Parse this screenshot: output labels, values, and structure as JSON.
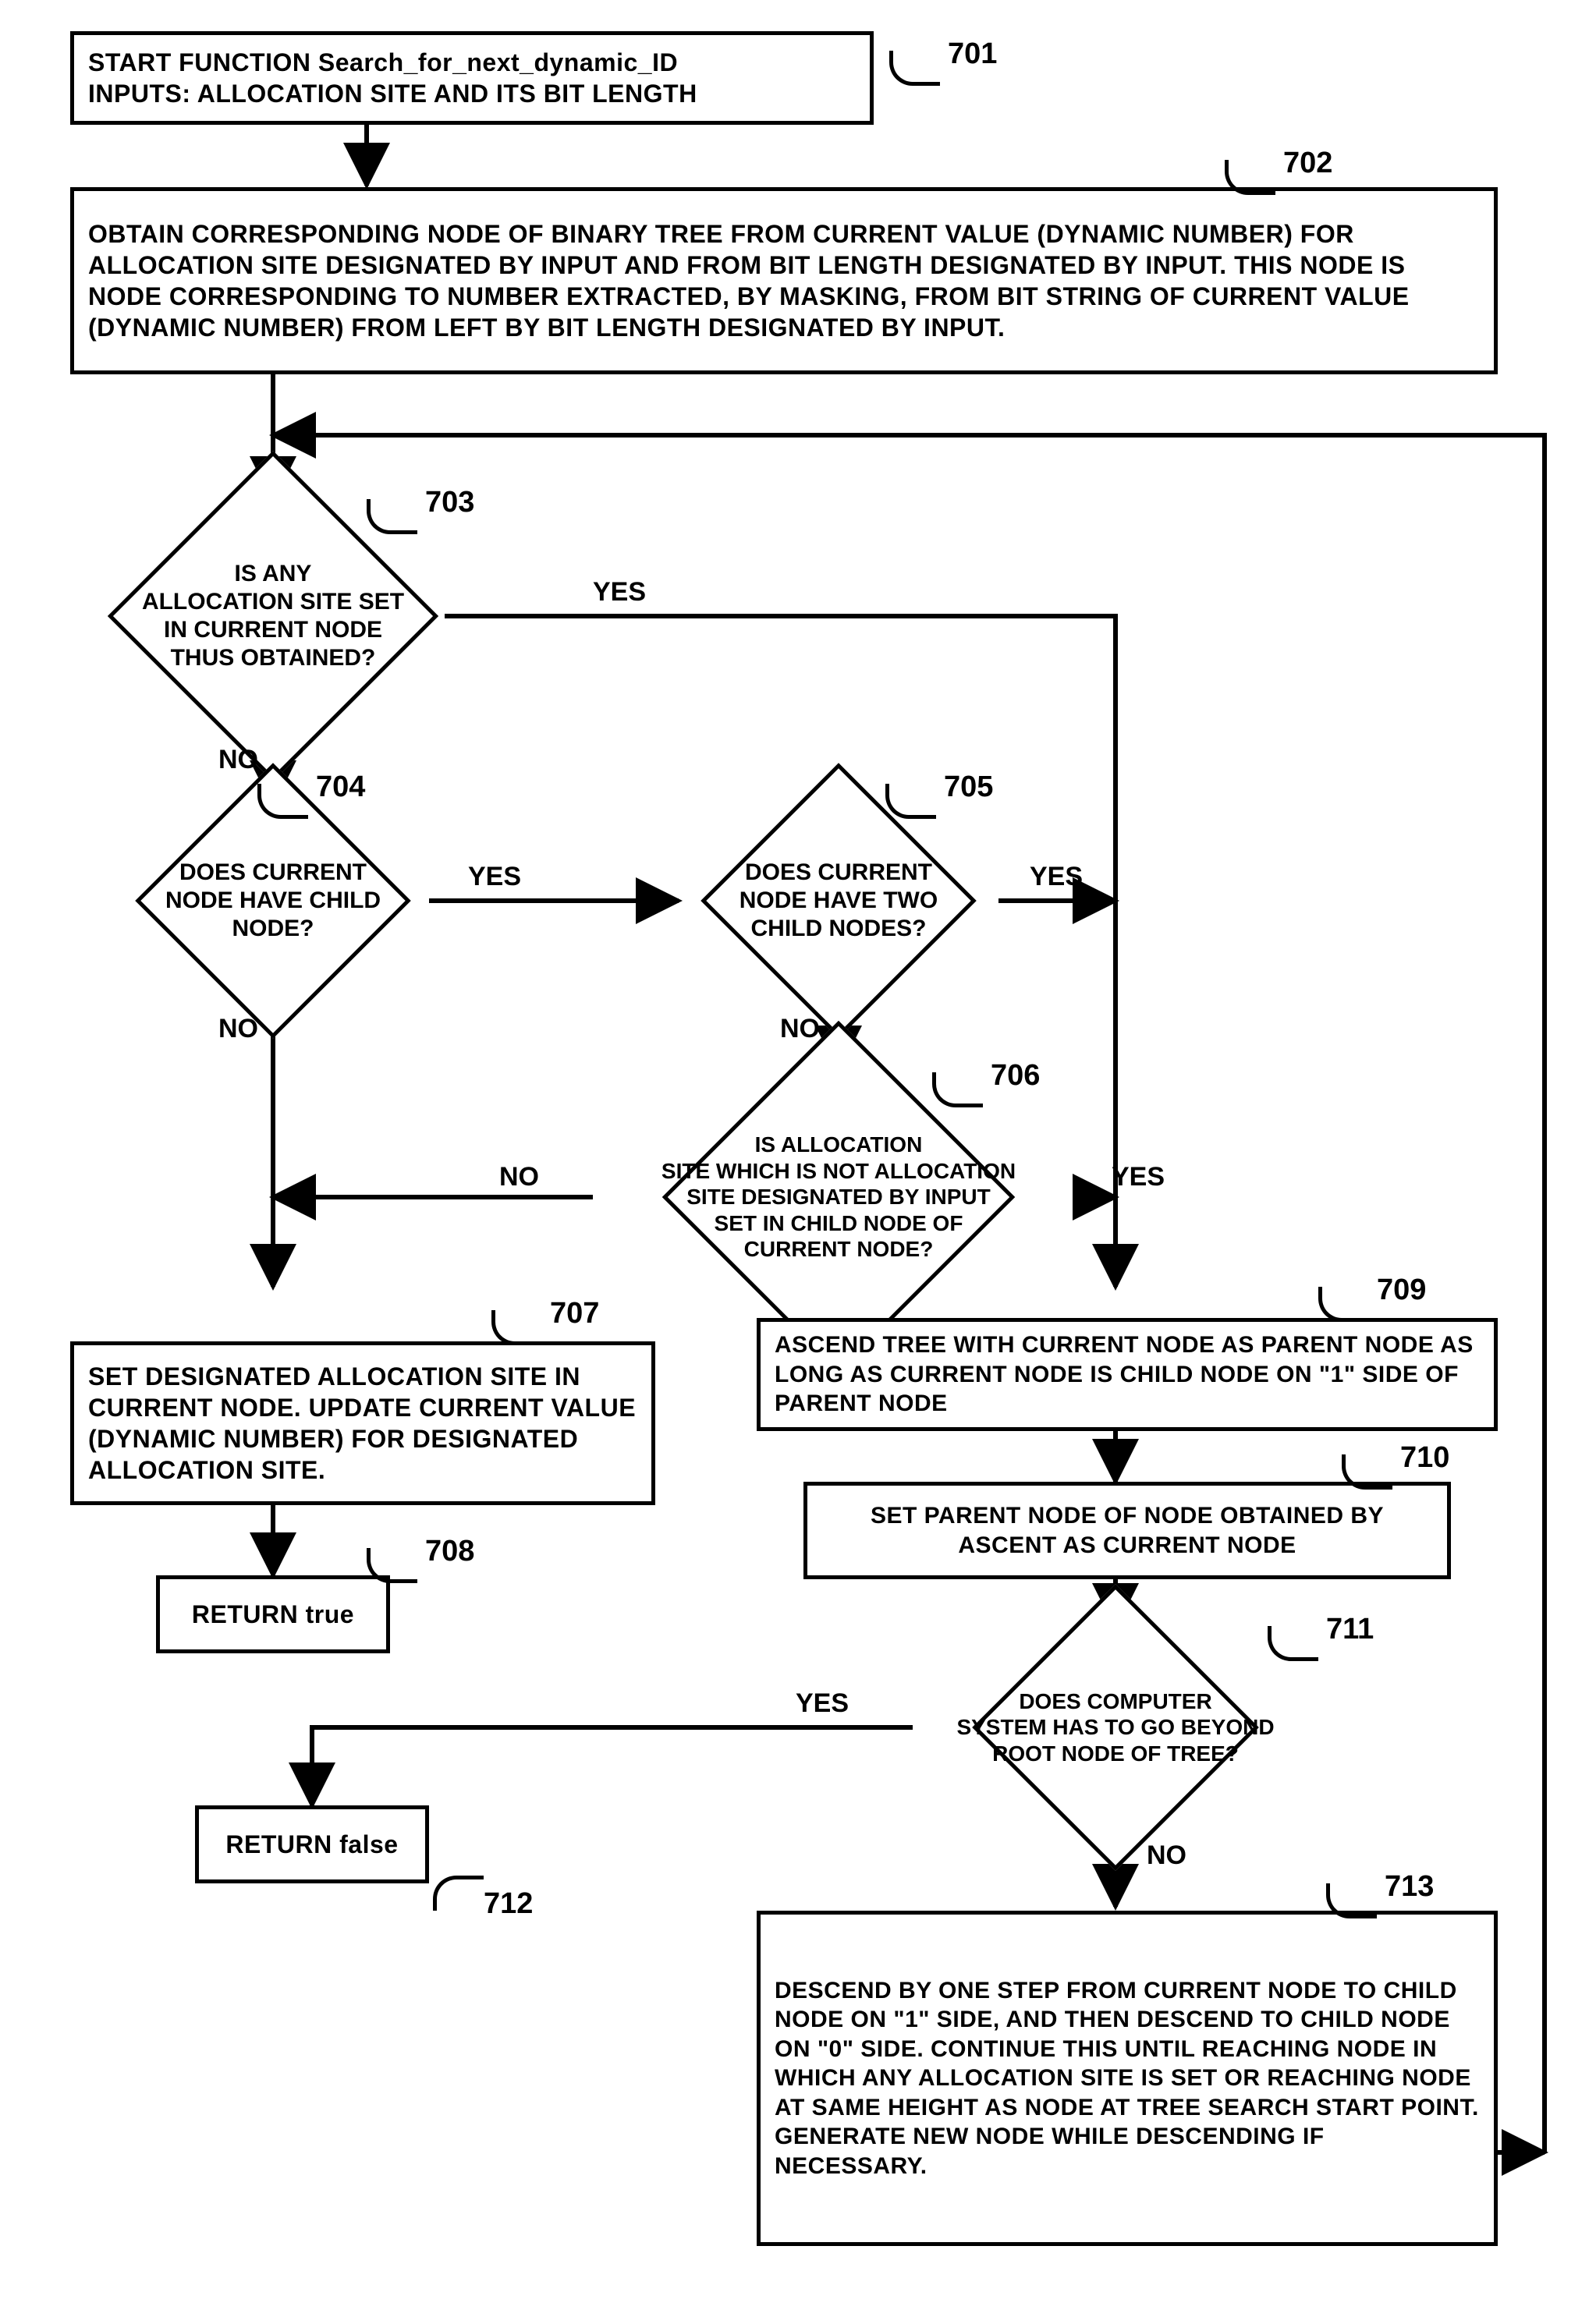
{
  "chart_data": {
    "type": "flowchart",
    "title": "Search_for_next_dynamic_ID",
    "nodes": [
      {
        "id": "701",
        "kind": "process",
        "text": "START FUNCTION Search_for_next_dynamic_ID\nINPUTS: ALLOCATION SITE AND ITS BIT LENGTH"
      },
      {
        "id": "702",
        "kind": "process",
        "text": "OBTAIN CORRESPONDING NODE OF BINARY TREE FROM CURRENT VALUE (DYNAMIC NUMBER) FOR ALLOCATION SITE DESIGNATED BY INPUT AND FROM BIT LENGTH DESIGNATED BY INPUT. THIS NODE IS NODE CORRESPONDING TO NUMBER EXTRACTED, BY MASKING, FROM BIT STRING OF CURRENT VALUE (DYNAMIC NUMBER) FROM LEFT BY BIT LENGTH DESIGNATED BY INPUT."
      },
      {
        "id": "703",
        "kind": "decision",
        "text": "IS ANY ALLOCATION SITE SET IN CURRENT NODE THUS OBTAINED?"
      },
      {
        "id": "704",
        "kind": "decision",
        "text": "DOES CURRENT NODE HAVE CHILD NODE?"
      },
      {
        "id": "705",
        "kind": "decision",
        "text": "DOES CURRENT NODE HAVE TWO CHILD NODES?"
      },
      {
        "id": "706",
        "kind": "decision",
        "text": "IS ALLOCATION SITE WHICH IS NOT ALLOCATION SITE DESIGNATED BY INPUT SET IN CHILD NODE OF CURRENT NODE?"
      },
      {
        "id": "707",
        "kind": "process",
        "text": "SET DESIGNATED ALLOCATION SITE IN CURRENT NODE. UPDATE CURRENT VALUE (DYNAMIC NUMBER) FOR DESIGNATED ALLOCATION SITE."
      },
      {
        "id": "708",
        "kind": "terminator",
        "text": "RETURN true"
      },
      {
        "id": "709",
        "kind": "process",
        "text": "ASCEND TREE WITH CURRENT NODE AS PARENT NODE AS LONG AS CURRENT NODE IS CHILD NODE ON \"1\" SIDE OF PARENT NODE"
      },
      {
        "id": "710",
        "kind": "process",
        "text": "SET PARENT NODE OF NODE OBTAINED BY ASCENT AS CURRENT NODE"
      },
      {
        "id": "711",
        "kind": "decision",
        "text": "DOES COMPUTER SYSTEM HAS TO GO BEYOND ROOT NODE OF TREE?"
      },
      {
        "id": "712",
        "kind": "terminator",
        "text": "RETURN false"
      },
      {
        "id": "713",
        "kind": "process",
        "text": "DESCEND BY ONE STEP FROM CURRENT NODE TO CHILD NODE ON \"1\" SIDE, AND THEN DESCEND TO CHILD NODE ON \"0\" SIDE. CONTINUE THIS UNTIL REACHING NODE IN WHICH ANY ALLOCATION SITE IS SET OR REACHING NODE AT SAME HEIGHT AS NODE AT TREE SEARCH START POINT. GENERATE NEW NODE WHILE DESCENDING IF NECESSARY."
      }
    ],
    "edges": [
      {
        "from": "701",
        "to": "702"
      },
      {
        "from": "702",
        "to": "703"
      },
      {
        "from": "703",
        "to": "704",
        "label": "NO"
      },
      {
        "from": "703",
        "to": "709",
        "label": "YES"
      },
      {
        "from": "704",
        "to": "707",
        "label": "NO"
      },
      {
        "from": "704",
        "to": "705",
        "label": "YES"
      },
      {
        "from": "705",
        "to": "706",
        "label": "NO"
      },
      {
        "from": "705",
        "to": "709",
        "label": "YES"
      },
      {
        "from": "706",
        "to": "707",
        "label": "NO"
      },
      {
        "from": "706",
        "to": "709",
        "label": "YES"
      },
      {
        "from": "707",
        "to": "708"
      },
      {
        "from": "709",
        "to": "710"
      },
      {
        "from": "710",
        "to": "711"
      },
      {
        "from": "711",
        "to": "712",
        "label": "YES"
      },
      {
        "from": "711",
        "to": "713",
        "label": "NO"
      },
      {
        "from": "713",
        "to": "703",
        "label": "loop back"
      }
    ]
  },
  "refs": {
    "n701": "701",
    "n702": "702",
    "n703": "703",
    "n704": "704",
    "n705": "705",
    "n706": "706",
    "n707": "707",
    "n708": "708",
    "n709": "709",
    "n710": "710",
    "n711": "711",
    "n712": "712",
    "n713": "713"
  },
  "labels": {
    "yes": "YES",
    "no": "NO"
  },
  "text": {
    "n701": "START FUNCTION Search_for_next_dynamic_ID\nINPUTS: ALLOCATION SITE AND ITS BIT LENGTH",
    "n702": "OBTAIN CORRESPONDING NODE OF BINARY TREE FROM CURRENT VALUE (DYNAMIC NUMBER) FOR ALLOCATION SITE DESIGNATED BY INPUT AND FROM BIT LENGTH DESIGNATED BY INPUT. THIS NODE IS NODE CORRESPONDING TO NUMBER EXTRACTED, BY MASKING, FROM BIT STRING OF CURRENT VALUE (DYNAMIC NUMBER) FROM LEFT BY BIT LENGTH DESIGNATED BY INPUT.",
    "n703": "IS ANY\nALLOCATION SITE SET\nIN CURRENT NODE\nTHUS OBTAINED?",
    "n704": "DOES CURRENT\nNODE HAVE CHILD\nNODE?",
    "n705": "DOES CURRENT\nNODE HAVE TWO\nCHILD NODES?",
    "n706": "IS ALLOCATION\nSITE WHICH IS NOT ALLOCATION\nSITE DESIGNATED BY INPUT\nSET IN CHILD NODE OF\nCURRENT NODE?",
    "n707": "SET DESIGNATED ALLOCATION SITE IN CURRENT NODE.  UPDATE CURRENT VALUE (DYNAMIC NUMBER) FOR DESIGNATED ALLOCATION SITE.",
    "n708": "RETURN true",
    "n709": "ASCEND TREE WITH CURRENT NODE AS PARENT NODE AS LONG AS CURRENT NODE IS CHILD NODE ON \"1\" SIDE OF PARENT NODE",
    "n710": "SET PARENT NODE OF NODE OBTAINED BY ASCENT AS CURRENT NODE",
    "n711": "DOES COMPUTER\nSYSTEM HAS TO GO BEYOND\nROOT NODE OF TREE?",
    "n712": "RETURN false",
    "n713": "DESCEND BY ONE STEP FROM CURRENT NODE TO CHILD NODE ON \"1\" SIDE, AND THEN DESCEND TO CHILD NODE ON \"0\" SIDE.  CONTINUE THIS UNTIL REACHING NODE IN WHICH ANY ALLOCATION SITE IS SET OR REACHING NODE AT SAME HEIGHT AS NODE AT TREE SEARCH START POINT. GENERATE NEW NODE WHILE DESCENDING IF NECESSARY."
  }
}
